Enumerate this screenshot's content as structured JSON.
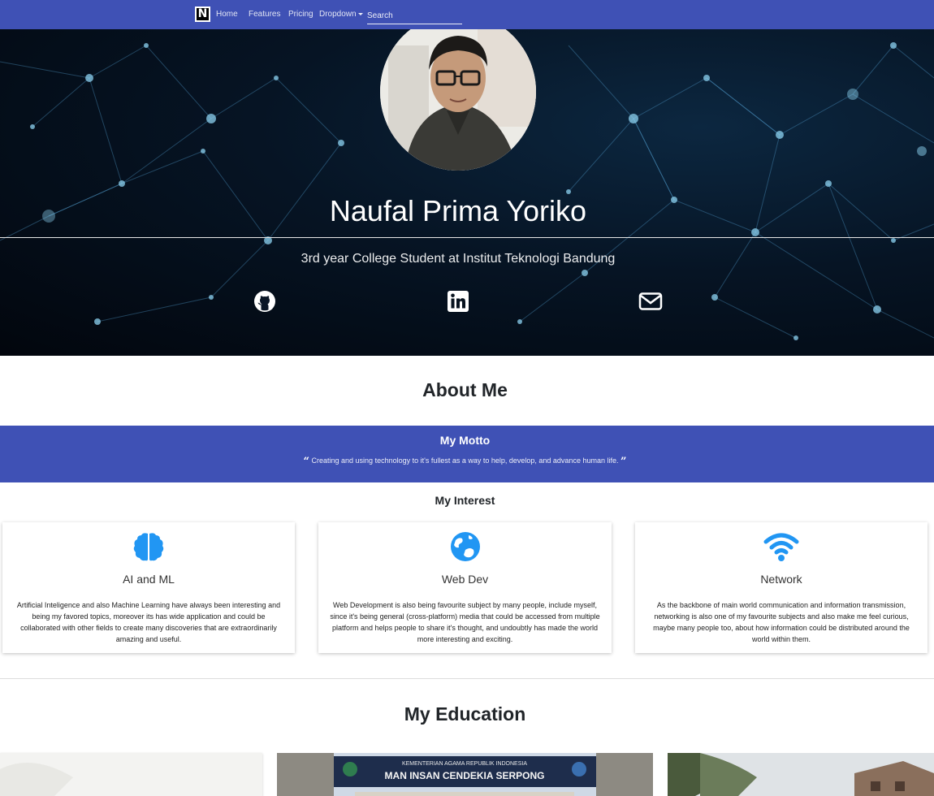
{
  "nav": {
    "brand_letter": "N",
    "links": [
      "Home",
      "Features",
      "Pricing",
      "Dropdown"
    ],
    "search_placeholder": "Search"
  },
  "hero": {
    "name": "Naufal Prima Yoriko",
    "subtitle": "3rd year College Student at Institut Teknologi Bandung",
    "social_icons": [
      "github-icon",
      "linkedin-icon",
      "envelope-icon"
    ]
  },
  "about": {
    "title": "About Me",
    "motto_title": "My Motto",
    "motto_text": "Creating and using technology to it's fullest as a way to help, develop, and advance human life.",
    "interest_title": "My Interest"
  },
  "interests": [
    {
      "icon": "brain-icon",
      "title": "AI and ML",
      "description": "Artificial Inteligence and also Machine Learning have always been interesting and being my favored topics, moreover its has wide application and could be collaborated with other fields to create many discoveries that are extraordinarily amazing and useful."
    },
    {
      "icon": "globe-icon",
      "title": "Web Dev",
      "description": "Web Development is also being favourite subject by many people, include myself, since it's being general (cross-platform) media that could be accessed from multiple platform and helps people to share it's thought, and undoubtly has made the world more interesting and exciting."
    },
    {
      "icon": "wifi-icon",
      "title": "Network",
      "description": "As the backbone of main world communication and information transmission, networking is also one of my favourite subjects and also make me feel curious, maybe many people too, about how information could be distributed around the world within them."
    }
  ],
  "education": {
    "title": "My Education",
    "images": [
      {
        "caption_line1": ""
      },
      {
        "caption_line1": "KEMENTERIAN AGAMA REPUBLIK INDONESIA",
        "caption_line2": "MAN INSAN CENDEKIA SERPONG"
      },
      {
        "caption_line1": ""
      }
    ]
  },
  "colors": {
    "primary": "#3f51b5",
    "icon_blue": "#2196f3"
  }
}
